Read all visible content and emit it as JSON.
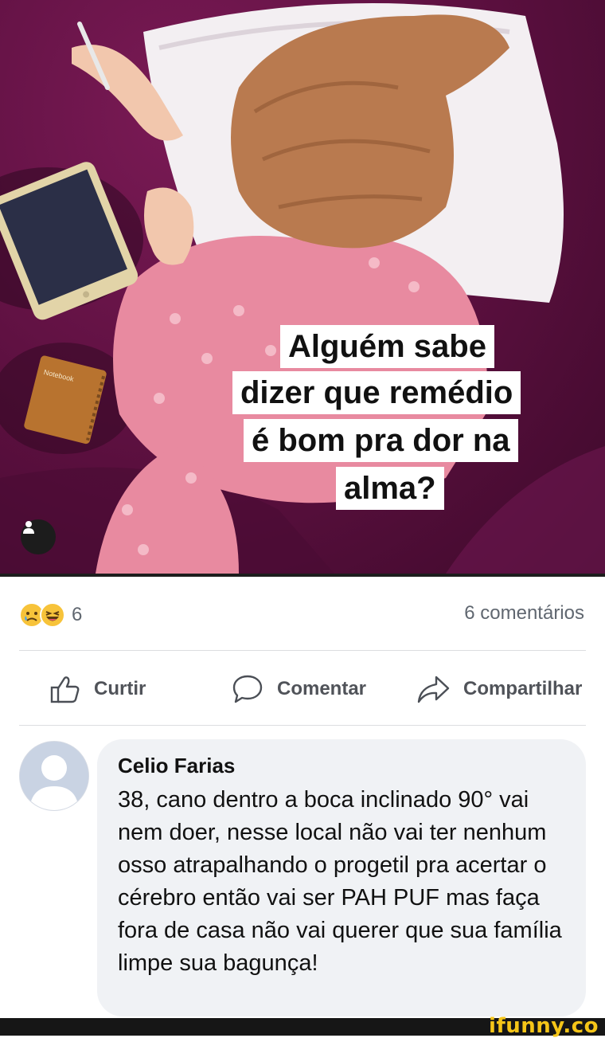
{
  "post": {
    "image": {
      "caption_lines": [
        "Alguém sabe",
        "dizer que remédio",
        "é bom pra dor na",
        "alma?"
      ],
      "notebook_label": "Notebook",
      "icons": {
        "profile": "person-icon"
      },
      "colors": {
        "background": "#5a0f3e",
        "pajama": "#e88aa0",
        "hair": "#b97a4f",
        "pillow": "#f3eff2"
      }
    },
    "reactions": {
      "icons": [
        "sad-face-emoji",
        "laughing-face-emoji"
      ],
      "count": "6"
    },
    "comments_count": "6 comentários",
    "actions": {
      "like": {
        "label": "Curtir",
        "icon": "thumbs-up-icon"
      },
      "comment": {
        "label": "Comentar",
        "icon": "speech-bubble-icon"
      },
      "share": {
        "label": "Compartilhar",
        "icon": "share-arrow-icon"
      }
    },
    "comment": {
      "author": "Celio Farias",
      "text": "38, cano dentro a boca inclinado 90° vai nem doer, nesse local não vai ter nenhum osso atrapalhando o progetil pra acertar o cérebro então vai ser PAH PUF mas faça fora de casa não vai querer que sua família limpe sua bagunça!"
    }
  },
  "footer": {
    "watermark": "ifunny.co"
  }
}
